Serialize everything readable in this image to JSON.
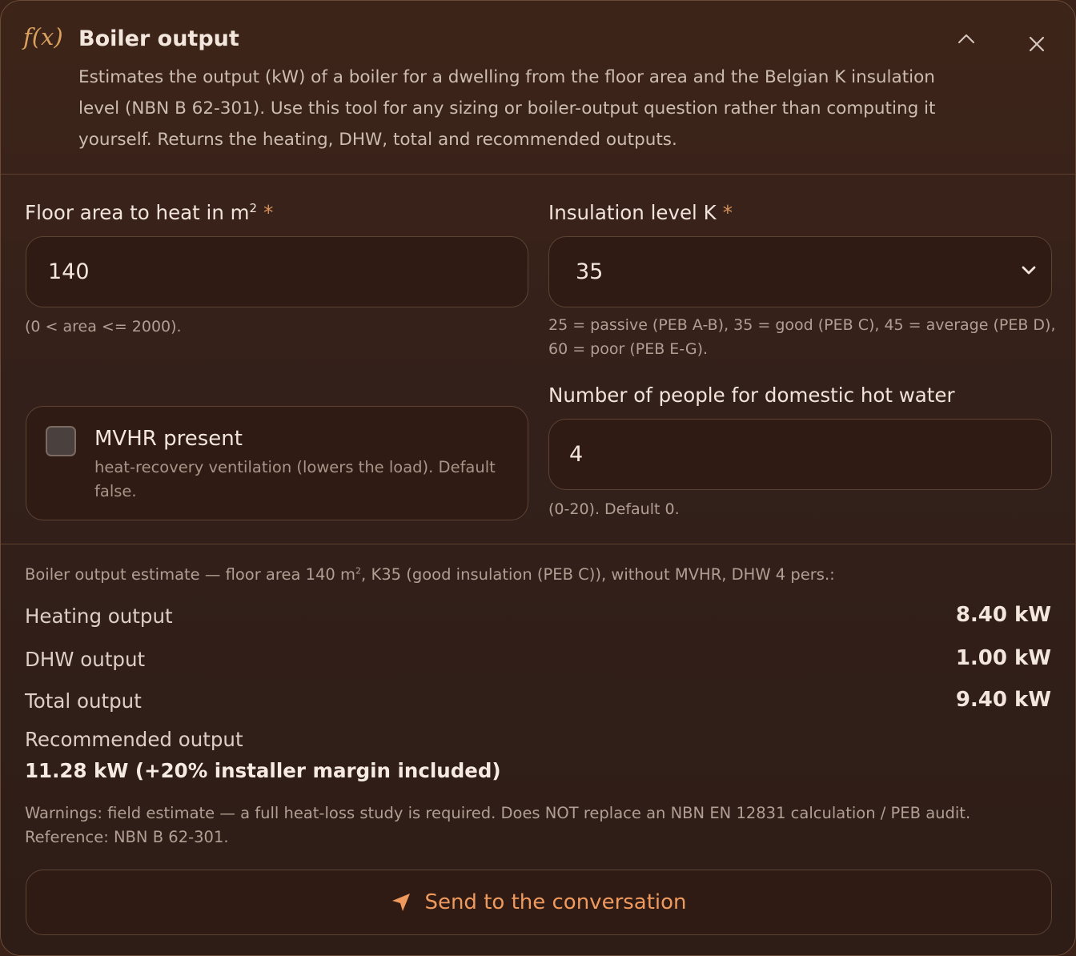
{
  "header": {
    "fx_label": "f(x)",
    "title": "Boiler output",
    "description": "Estimates the output (kW) of a boiler for a dwelling from the floor area and the Belgian K insulation level (NBN B 62-301). Use this tool for any sizing or boiler-output question rather than computing it yourself. Returns the heating, DHW, total and recommended outputs.",
    "collapse_icon": "chevron-up-icon",
    "close_icon": "close-icon"
  },
  "form": {
    "floor_area": {
      "label": "Floor area to heat in m",
      "label_superscript": "2",
      "required_mark": "*",
      "value": "140",
      "hint": "(0 < area <= 2000)."
    },
    "insulation": {
      "label": "Insulation level K",
      "required_mark": "*",
      "value": "35",
      "hint_line1": "25 = passive (PEB A-B), 35 = good (PEB C), 45 = average (PEB D),",
      "hint_line2": "60 = poor (PEB E-G)."
    },
    "mvhr": {
      "title": "MVHR present",
      "description": "heat-recovery ventilation (lowers the load). Default false.",
      "checked": false
    },
    "people": {
      "label": "Number of people for domestic hot water",
      "value": "4",
      "hint": "(0-20). Default 0."
    }
  },
  "results": {
    "summary_part1": "Boiler output estimate — floor area 140 m",
    "summary_sup": "2",
    "summary_part2": ", K35 (good insulation (PEB C)), without MVHR, DHW 4 pers.:",
    "heating_label": "Heating output",
    "heating_value": "8.40 kW",
    "dhw_label": "DHW output",
    "dhw_value": "1.00 kW",
    "total_label": "Total output",
    "total_value": "9.40 kW",
    "recommended_label": "Recommended output",
    "recommended_value": "11.28 kW (+20% installer margin included)",
    "warnings": "Warnings: field estimate — a full heat-loss study is required. Does NOT replace an NBN EN 12831 calculation / PEB audit.",
    "reference": "Reference: NBN B 62-301."
  },
  "send": {
    "label": "Send to the conversation",
    "icon": "send-icon"
  },
  "colors": {
    "background": "#33201a",
    "accent": "#ee9a5e",
    "fx_accent": "#d9a05f",
    "border": "#5c4334"
  }
}
